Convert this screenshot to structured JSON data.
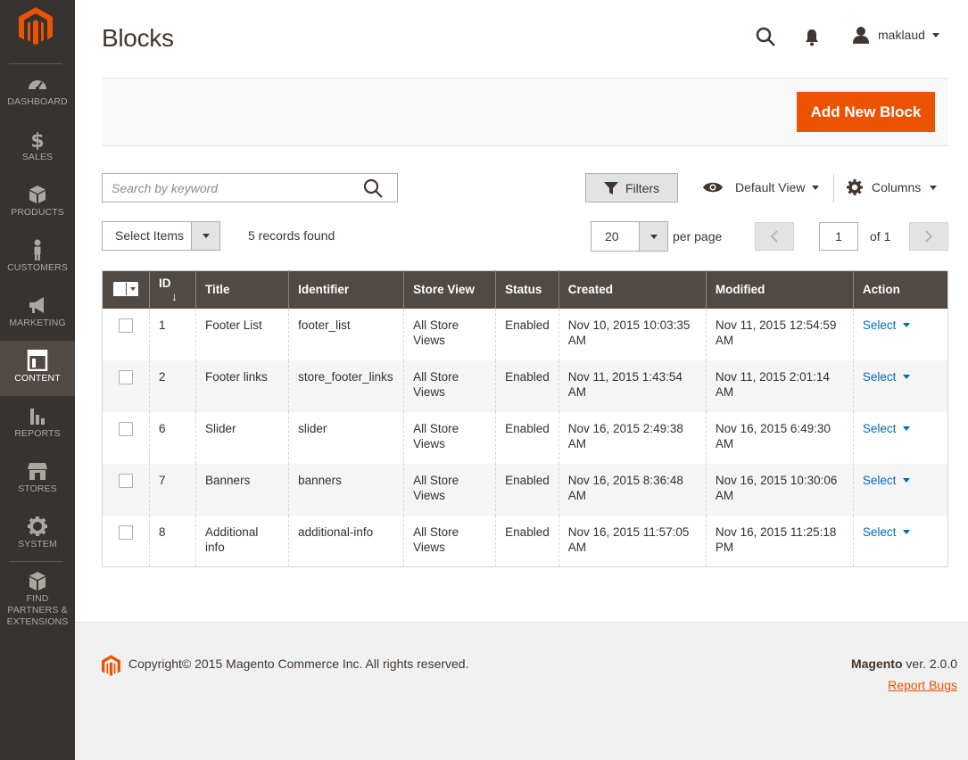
{
  "sidebar": {
    "items": [
      {
        "label": "DASHBOARD",
        "icon": "dashboard-icon"
      },
      {
        "label": "SALES",
        "icon": "dollar-icon"
      },
      {
        "label": "PRODUCTS",
        "icon": "box-icon"
      },
      {
        "label": "CUSTOMERS",
        "icon": "person-icon"
      },
      {
        "label": "MARKETING",
        "icon": "megaphone-icon"
      },
      {
        "label": "CONTENT",
        "icon": "layout-icon",
        "active": true
      },
      {
        "label": "REPORTS",
        "icon": "bar-chart-icon"
      },
      {
        "label": "STORES",
        "icon": "storefront-icon"
      },
      {
        "label": "SYSTEM",
        "icon": "gear-icon"
      },
      {
        "label": "FIND PARTNERS & EXTENSIONS",
        "icon": "extensions-icon"
      }
    ]
  },
  "header": {
    "title": "Blocks",
    "username": "maklaud"
  },
  "actions": {
    "add_new": "Add New Block"
  },
  "toolbar": {
    "search_placeholder": "Search by keyword",
    "filters": "Filters",
    "view": "Default View",
    "columns": "Columns",
    "mass_action": "Select Items",
    "records": "5 records found",
    "per_page_value": "20",
    "per_page_label": "per page",
    "page_current": "1",
    "page_of": "of 1"
  },
  "grid": {
    "columns": [
      "ID",
      "Title",
      "Identifier",
      "Store View",
      "Status",
      "Created",
      "Modified",
      "Action"
    ],
    "rows": [
      {
        "id": "1",
        "title": "Footer List",
        "identifier": "footer_list",
        "store_view": "All Store Views",
        "status": "Enabled",
        "created": "Nov 10, 2015 10:03:35 AM",
        "modified": "Nov 11, 2015 12:54:59 AM",
        "action": "Select"
      },
      {
        "id": "2",
        "title": "Footer links",
        "identifier": "store_footer_links",
        "store_view": "All Store Views",
        "status": "Enabled",
        "created": "Nov 11, 2015 1:43:54 AM",
        "modified": "Nov 11, 2015 2:01:14 AM",
        "action": "Select"
      },
      {
        "id": "6",
        "title": "Slider",
        "identifier": "slider",
        "store_view": "All Store Views",
        "status": "Enabled",
        "created": "Nov 16, 2015 2:49:38 AM",
        "modified": "Nov 16, 2015 6:49:30 AM",
        "action": "Select"
      },
      {
        "id": "7",
        "title": "Banners",
        "identifier": "banners",
        "store_view": "All Store Views",
        "status": "Enabled",
        "created": "Nov 16, 2015 8:36:48 AM",
        "modified": "Nov 16, 2015 10:30:06 AM",
        "action": "Select"
      },
      {
        "id": "8",
        "title": "Additional info",
        "identifier": "additional-info",
        "store_view": "All Store Views",
        "status": "Enabled",
        "created": "Nov 16, 2015 11:57:05 AM",
        "modified": "Nov 16, 2015 11:25:18 PM",
        "action": "Select"
      }
    ]
  },
  "footer": {
    "copyright": "Copyright© 2015 Magento Commerce Inc. All rights reserved.",
    "brand": "Magento",
    "version": " ver. 2.0.0",
    "report": "Report Bugs"
  },
  "colors": {
    "sidebar_bg": "#373330",
    "accent": "#eb5202",
    "grid_header": "#514943",
    "link": "#006bb4"
  }
}
